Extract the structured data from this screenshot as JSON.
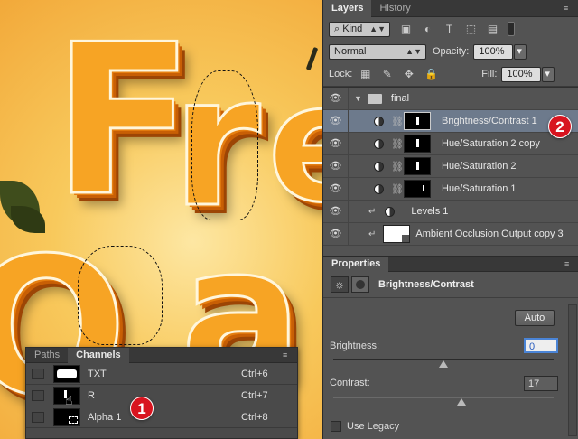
{
  "canvas": {
    "letters": [
      "F",
      "r",
      "e"
    ],
    "bottom_letters": [
      "O",
      "a"
    ]
  },
  "channels_panel": {
    "tabs": [
      "Paths",
      "Channels"
    ],
    "active_tab": "Channels",
    "menu_icon": "panel-menu-icon",
    "rows": [
      {
        "name": "TXT",
        "shortcut": "Ctrl+6"
      },
      {
        "name": "R",
        "shortcut": "Ctrl+7"
      },
      {
        "name": "Alpha 1",
        "shortcut": "Ctrl+8"
      }
    ]
  },
  "badges": {
    "one": "1",
    "two": "2"
  },
  "layers_panel": {
    "tabs": [
      "Layers",
      "History"
    ],
    "active_tab": "Layers",
    "filter": {
      "value": "Kind"
    },
    "blend_mode": "Normal",
    "opacity_label": "Opacity:",
    "opacity_value": "100%",
    "lock_label": "Lock:",
    "fill_label": "Fill:",
    "fill_value": "100%",
    "group_name": "final",
    "layers": [
      {
        "name": "Brightness/Contrast 1",
        "selected": true
      },
      {
        "name": "Hue/Saturation 2 copy",
        "selected": false
      },
      {
        "name": "Hue/Saturation 2",
        "selected": false
      },
      {
        "name": "Hue/Saturation 1",
        "selected": false
      },
      {
        "name": "Levels 1",
        "selected": false
      },
      {
        "name": "Ambient Occlusion Output copy 3",
        "selected": false
      }
    ]
  },
  "properties_panel": {
    "tab": "Properties",
    "adjustment_title": "Brightness/Contrast",
    "auto_label": "Auto",
    "brightness_label": "Brightness:",
    "brightness_value": "0",
    "brightness_level": 0.5,
    "contrast_label": "Contrast:",
    "contrast_value": "17",
    "contrast_level": 0.58,
    "legacy_label": "Use Legacy"
  },
  "colors": {
    "selected_layer": "#6d7a8c",
    "badge": "#d8141f",
    "orange": "#f7a424"
  }
}
